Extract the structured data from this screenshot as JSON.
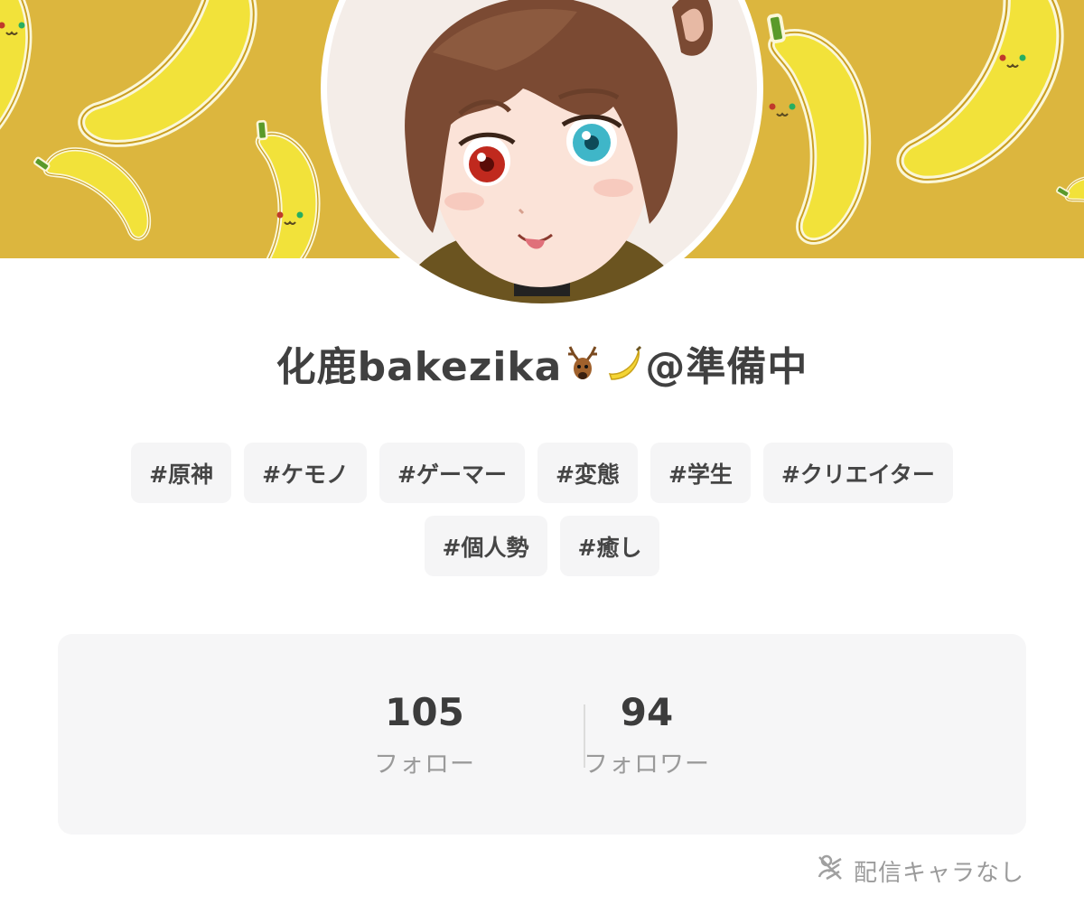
{
  "profile": {
    "name_text": "化鹿bakezika",
    "name_suffix": "@準備中",
    "name_emojis": [
      "deer-icon",
      "banana-icon"
    ]
  },
  "tags": [
    "#原神",
    "#ケモノ",
    "#ゲーマー",
    "#変態",
    "#学生",
    "#クリエイター",
    "#個人勢",
    "#癒し"
  ],
  "stats": {
    "follow_count": "105",
    "follow_label": "フォロー",
    "follower_count": "94",
    "follower_label": "フォロワー"
  },
  "footer": {
    "note_label": "配信キャラなし",
    "note_icon": "no-character-icon"
  },
  "colors": {
    "banner": "#dcb63e",
    "banana": "#f2e23a",
    "tag_bg": "#f5f5f6",
    "card_bg": "#f6f6f7"
  }
}
